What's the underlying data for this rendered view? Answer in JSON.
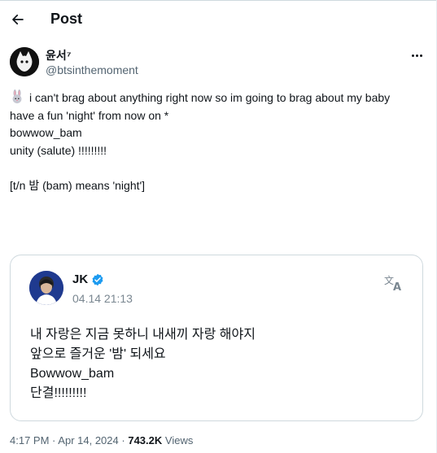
{
  "header": {
    "title": "Post"
  },
  "author": {
    "name": "윤서⁷",
    "handle": "@btsinthemoment"
  },
  "tweet": {
    "emoji": "bunny",
    "line1": "i can't brag about anything right now so im going to brag about my baby",
    "line2": "have a fun 'night' from now on *",
    "line3": "bowwow_bam",
    "line4": "unity (salute) !!!!!!!!!",
    "line5": "[t/n 밤 (bam) means 'night']"
  },
  "quote_card": {
    "name": "JK",
    "date": "04.14 21:13",
    "text_line1": "내 자랑은 지금 못하니 내새끼 자랑 해야지",
    "text_line2": "앞으로 즐거운 '밤' 되세요",
    "text_line3": "Bowwow_bam",
    "text_line4": "단결!!!!!!!!!"
  },
  "footer": {
    "time": "4:17 PM",
    "date": "Apr 14, 2024",
    "separator": "·",
    "views_count": "743.2K",
    "views_label": "Views"
  },
  "colors": {
    "verified": "#1d9bf0",
    "muted": "#536471",
    "border": "#cfd9de"
  },
  "icons": [
    "back-arrow-icon",
    "more-icon",
    "bunny-emoji-icon",
    "verified-icon",
    "translate-icon"
  ]
}
